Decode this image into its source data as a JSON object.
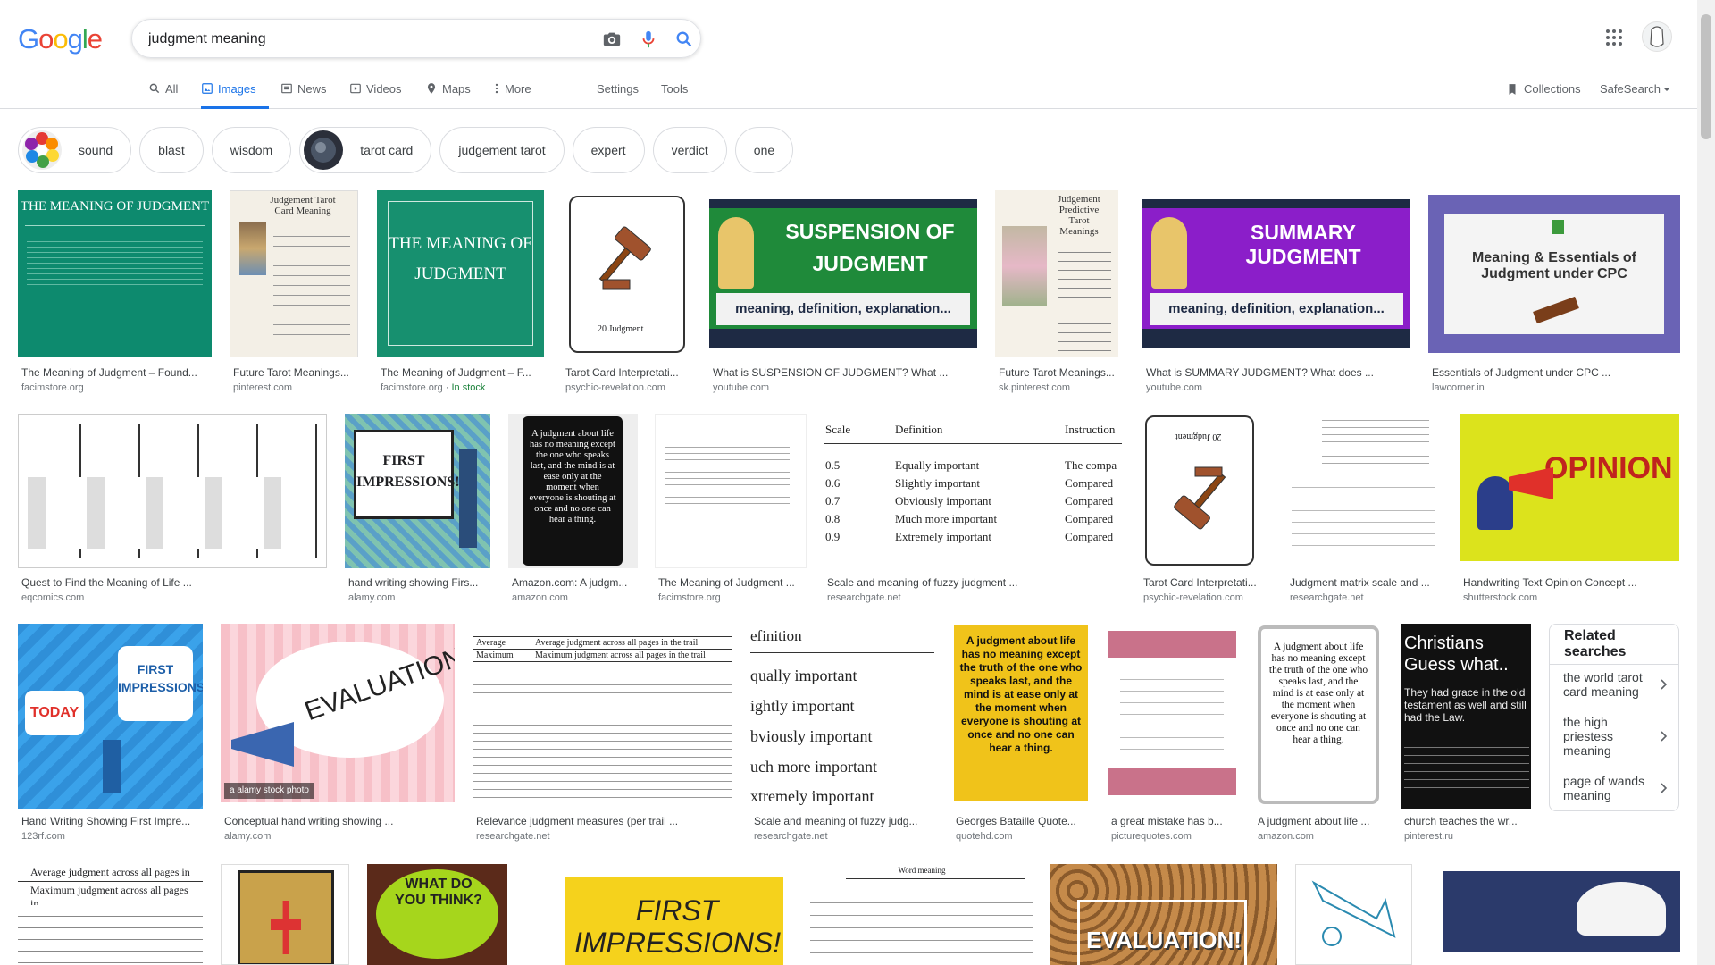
{
  "logo": [
    "G",
    "o",
    "o",
    "g",
    "l",
    "e"
  ],
  "search": {
    "query": "judgment meaning"
  },
  "tabs": [
    {
      "label": "All"
    },
    {
      "label": "Images"
    },
    {
      "label": "News"
    },
    {
      "label": "Videos"
    },
    {
      "label": "Maps"
    },
    {
      "label": "More"
    }
  ],
  "settings_label": "Settings",
  "tools_label": "Tools",
  "collections_label": "Collections",
  "safesearch_label": "SafeSearch",
  "chips": [
    "sound",
    "blast",
    "wisdom",
    "tarot card",
    "judgement tarot",
    "expert",
    "verdict",
    "one"
  ],
  "results": [
    {
      "caption": "The Meaning of Judgment – Found...",
      "source": "facimstore.org",
      "image_text": "THE MEANING OF JUDGMENT"
    },
    {
      "caption": "Future Tarot Meanings...",
      "source": "pinterest.com",
      "image_text": "Judgement Tarot Card Meaning"
    },
    {
      "caption": "The Meaning of Judgment – F...",
      "source": "facimstore.org",
      "stock": "In stock",
      "image_text": "THE MEANING OF JUDGMENT"
    },
    {
      "caption": "Tarot Card Interpretati...",
      "source": "psychic-revelation.com",
      "image_text": "20 Judgment"
    },
    {
      "caption": "What is SUSPENSION OF JUDGMENT? What ...",
      "source": "youtube.com",
      "image_text": "SUSPENSION OF JUDGMENT",
      "image_sub": "meaning, definition, explanation..."
    },
    {
      "caption": "Future Tarot Meanings...",
      "source": "sk.pinterest.com",
      "image_text": "Judgement Predictive Tarot Meanings"
    },
    {
      "caption": "What is SUMMARY JUDGMENT? What does ...",
      "source": "youtube.com",
      "image_text": "SUMMARY JUDGMENT",
      "image_sub": "meaning, definition, explanation..."
    },
    {
      "caption": "Essentials of Judgment under CPC ...",
      "source": "lawcorner.in",
      "image_text": "Meaning & Essentials of Judgment under CPC"
    },
    {
      "caption": "Quest to Find the Meaning of Life ...",
      "source": "eqcomics.com"
    },
    {
      "caption": "hand writing showing Firs...",
      "source": "alamy.com",
      "image_text": "FIRST IMPRESSIONS!"
    },
    {
      "caption": "Amazon.com: A judgm...",
      "source": "amazon.com",
      "image_text": "A judgment about life has no meaning except the one who speaks last, and the mind is at ease only at the moment when everyone is shouting at once and no one can hear a thing."
    },
    {
      "caption": "The Meaning of Judgment ...",
      "source": "facimstore.org"
    },
    {
      "caption": "Scale and meaning of fuzzy judgment ...",
      "source": "researchgate.net"
    },
    {
      "caption": "Tarot Card Interpretati...",
      "source": "psychic-revelation.com",
      "image_text": "20 Judgment"
    },
    {
      "caption": "Judgment matrix scale and ...",
      "source": "researchgate.net"
    },
    {
      "caption": "Handwriting Text Opinion Concept ...",
      "source": "shutterstock.com",
      "image_text": "OPINION"
    },
    {
      "caption": "Hand Writing Showing First Impre...",
      "source": "123rf.com",
      "image_text": "FIRST IMPRESSIONS!",
      "image_sub": "TODAY"
    },
    {
      "caption": "Conceptual hand writing showing ...",
      "source": "alamy.com",
      "image_text": "EVALUATION!"
    },
    {
      "caption": "Relevance judgment measures (per trail ...",
      "source": "researchgate.net"
    },
    {
      "caption": "Scale and meaning of fuzzy judg...",
      "source": "researchgate.net"
    },
    {
      "caption": "Georges Bataille Quote...",
      "source": "quotehd.com",
      "image_text": "A judgment about life has no meaning except the truth of the one who speaks last, and the mind is at ease only at the moment when everyone is shouting at once and no one can hear a thing."
    },
    {
      "caption": "a great mistake has b...",
      "source": "picturequotes.com"
    },
    {
      "caption": "A judgment about life ...",
      "source": "amazon.com",
      "image_text": "A judgment about life has no meaning except the truth of the one who speaks last, and the mind is at ease only at the moment when everyone is shouting at once and no one can hear a thing."
    },
    {
      "caption": "church teaches the wr...",
      "source": "pinterest.ru",
      "image_text": "Christians Guess what..",
      "image_sub": "They had grace in the old testament as well and still had the Law."
    }
  ],
  "fuzzy_table": {
    "headers": [
      "Scale",
      "Definition",
      "Instruction"
    ],
    "rows": [
      [
        "0.5",
        "Equally important",
        "The compa"
      ],
      [
        "0.6",
        "Slightly important",
        "Compared"
      ],
      [
        "0.7",
        "Obviously important",
        "Compared"
      ],
      [
        "0.8",
        "Much more important",
        "Compared"
      ],
      [
        "0.9",
        "Extremely important",
        "Compared"
      ]
    ]
  },
  "fuzzy_zoom": [
    "efinition",
    "qually important",
    "ightly important",
    "bviously important",
    "uch more important",
    "xtremely important"
  ],
  "relevance_table": {
    "rows": [
      [
        "Average",
        "Average judgment across all pages in the trail"
      ],
      [
        "Maximum",
        "Maximum judgment across all pages in the trail"
      ]
    ]
  },
  "bottom_row_texts": {
    "table_rows": [
      "Average judgment across all pages in",
      "Maximum judgment across all pages in"
    ],
    "what_do_you_think": "WHAT DO YOU THINK?",
    "first_impressions": "FIRST IMPRESSIONS!",
    "word_meaning": "Word meaning",
    "evaluation": "EVALUATION!"
  },
  "related": {
    "title": "Related searches",
    "items": [
      "the world tarot card meaning",
      "the high priestess meaning",
      "page of wands meaning"
    ]
  },
  "colors": {
    "blue": "#4285f4",
    "red": "#ea4335",
    "yellow": "#fbbc05",
    "green": "#34a853",
    "active_tab": "#1a73e8"
  }
}
